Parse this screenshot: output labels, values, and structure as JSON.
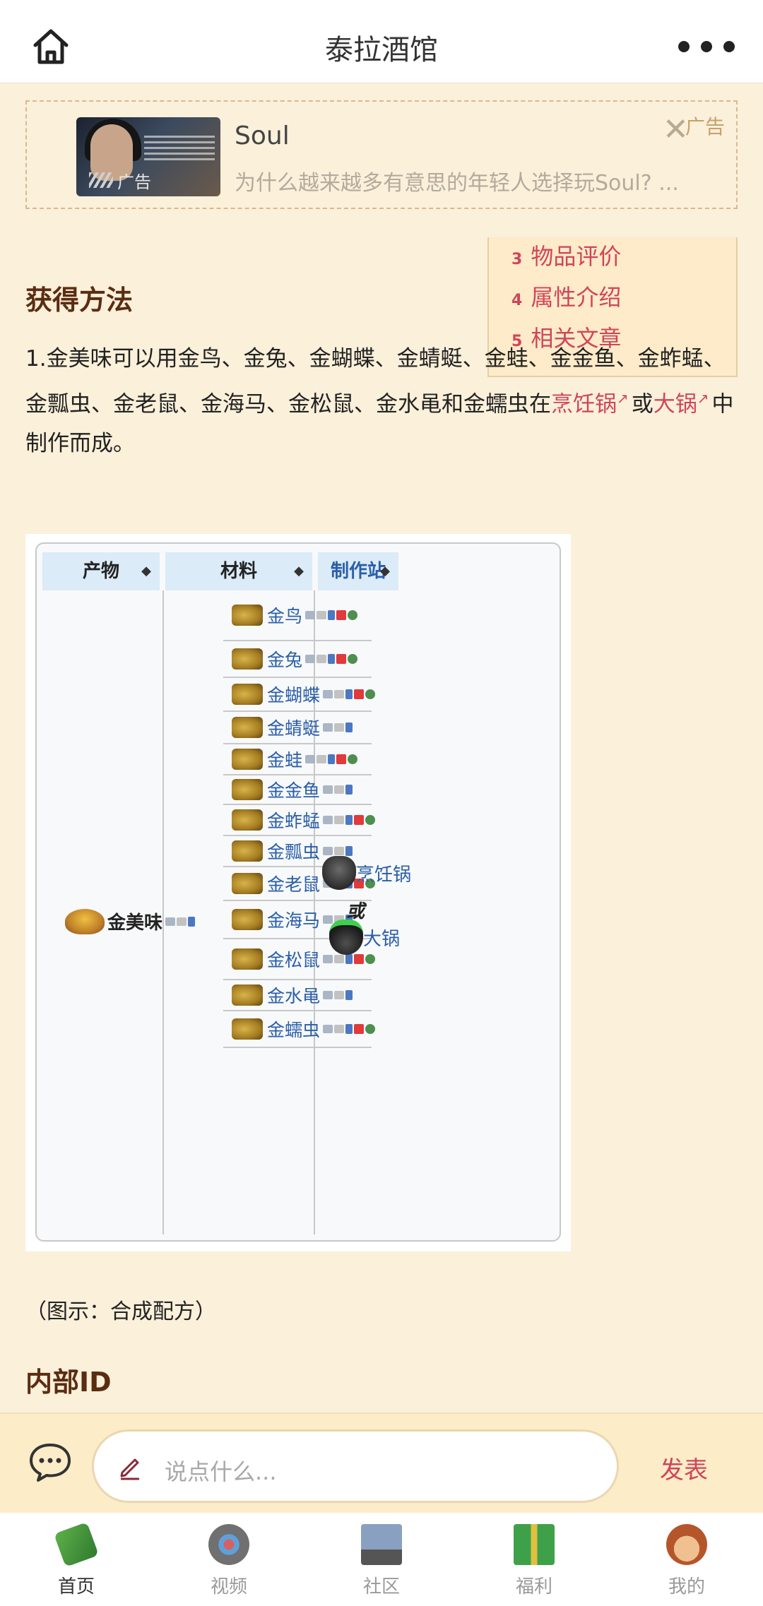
{
  "header": {
    "title": "泰拉酒馆"
  },
  "ad": {
    "thumb_label": "广告",
    "name": "Soul",
    "description": "为什么越来越多有意思的年轻人选择玩Soul? ...",
    "label": "广告"
  },
  "toc": {
    "items": [
      {
        "num": "3",
        "label": "物品评价"
      },
      {
        "num": "4",
        "label": "属性介绍"
      },
      {
        "num": "5",
        "label": "相关文章"
      }
    ]
  },
  "section_obtain": {
    "heading": "获得方法",
    "text_before": "1.金美味可以用金鸟、金兔、金蝴蝶、金蜻蜓、金蛙、金金鱼、金蚱蜢、金瓢虫、金老鼠、金海马、金松鼠、金水黾和金蠕虫在",
    "link1": "烹饪锅",
    "text_mid": "或",
    "link2": "大锅",
    "text_after": "中制作而成。"
  },
  "table": {
    "headers": [
      "产物",
      "材料",
      "制作站"
    ],
    "product": "金美味",
    "materials": [
      {
        "name": "金鸟",
        "platforms": [
          "pc",
          "pad",
          "mob",
          "sw",
          "gl"
        ]
      },
      {
        "name": "金兔",
        "platforms": [
          "pc",
          "pad",
          "mob",
          "sw",
          "gl"
        ]
      },
      {
        "name": "金蝴蝶",
        "platforms": [
          "pc",
          "pad",
          "mob",
          "sw",
          "gl"
        ]
      },
      {
        "name": "金蜻蜓",
        "platforms": [
          "pc",
          "pad",
          "mob"
        ]
      },
      {
        "name": "金蛙",
        "platforms": [
          "pc",
          "pad",
          "mob",
          "sw",
          "gl"
        ]
      },
      {
        "name": "金金鱼",
        "platforms": [
          "pc",
          "pad",
          "mob"
        ]
      },
      {
        "name": "金蚱蜢",
        "platforms": [
          "pc",
          "pad",
          "mob",
          "sw",
          "gl"
        ]
      },
      {
        "name": "金瓢虫",
        "platforms": [
          "pc",
          "pad",
          "mob"
        ]
      },
      {
        "name": "金老鼠",
        "platforms": [
          "pc",
          "pad",
          "mob",
          "sw",
          "gl"
        ]
      },
      {
        "name": "金海马",
        "platforms": [
          "pc",
          "pad",
          "mob"
        ]
      },
      {
        "name": "金松鼠",
        "platforms": [
          "pc",
          "pad",
          "mob",
          "sw",
          "gl"
        ]
      },
      {
        "name": "金水黾",
        "platforms": [
          "pc",
          "pad",
          "mob"
        ]
      },
      {
        "name": "金蠕虫",
        "platforms": [
          "pc",
          "pad",
          "mob",
          "sw",
          "gl"
        ]
      }
    ],
    "stations": [
      "烹饪锅",
      "大锅"
    ],
    "or_text": "或"
  },
  "caption": "（图示：合成配方）",
  "section_id": {
    "heading": "内部ID"
  },
  "comment": {
    "placeholder": "说点什么...",
    "send": "发表"
  },
  "tabbar": {
    "items": [
      {
        "label": "首页",
        "icon": "book-icon",
        "active": true
      },
      {
        "label": "视频",
        "icon": "tv-icon",
        "active": false
      },
      {
        "label": "社区",
        "icon": "board-icon",
        "active": false
      },
      {
        "label": "福利",
        "icon": "gift-icon",
        "active": false
      },
      {
        "label": "我的",
        "icon": "avatar-icon",
        "active": false
      }
    ]
  }
}
